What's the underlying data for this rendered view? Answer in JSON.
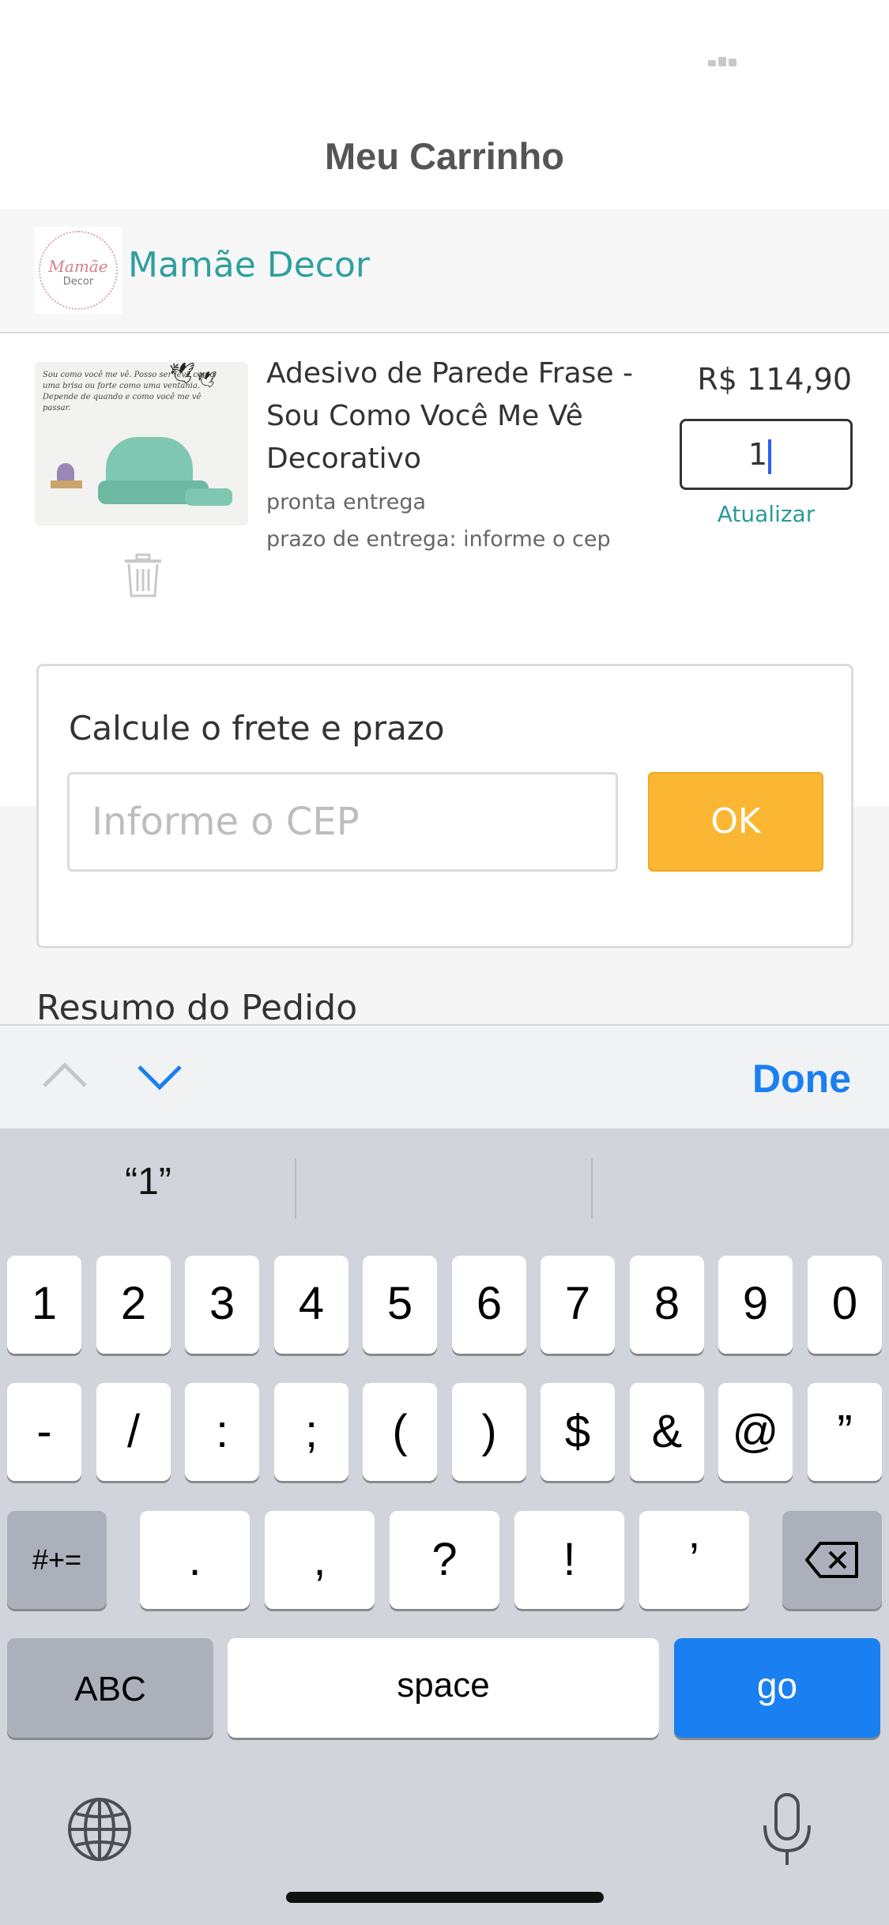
{
  "header": {
    "title": "Meu Carrinho"
  },
  "store": {
    "name": "Mamãe Decor",
    "logo_text": "Mamãe",
    "logo_sub": "Decor"
  },
  "cart_item": {
    "title": "Adesivo de Parede Frase - Sou Como Você Me Vê Decorativo",
    "stock": "pronta entrega",
    "delivery": "prazo de entrega: informe o cep",
    "price": "R$ 114,90",
    "quantity": "1",
    "update_label": "Atualizar",
    "image_quote": "Sou como você me vê. Posso ser leve como uma brisa ou forte como uma ventania. Depende de quando e como você me vê passar."
  },
  "freight": {
    "title": "Calcule o frete e prazo",
    "cep_placeholder": "Informe o CEP",
    "ok_label": "OK"
  },
  "summary": {
    "title": "Resumo do Pedido"
  },
  "keyboard_toolbar": {
    "done_label": "Done"
  },
  "keyboard": {
    "suggestions": [
      "“1”",
      "",
      ""
    ],
    "row1": [
      "1",
      "2",
      "3",
      "4",
      "5",
      "6",
      "7",
      "8",
      "9",
      "0"
    ],
    "row2": [
      "-",
      "/",
      ":",
      ";",
      "(",
      ")",
      "$",
      "&",
      "@",
      "”"
    ],
    "row3_mode": "#+=",
    "row3": [
      ".",
      ",",
      "?",
      "!",
      "’"
    ],
    "abc_label": "ABC",
    "space_label": "space",
    "go_label": "go"
  },
  "colors": {
    "accent": "#2fa0a0",
    "ok_button": "#fbb733",
    "ios_blue": "#1a7ff0"
  }
}
